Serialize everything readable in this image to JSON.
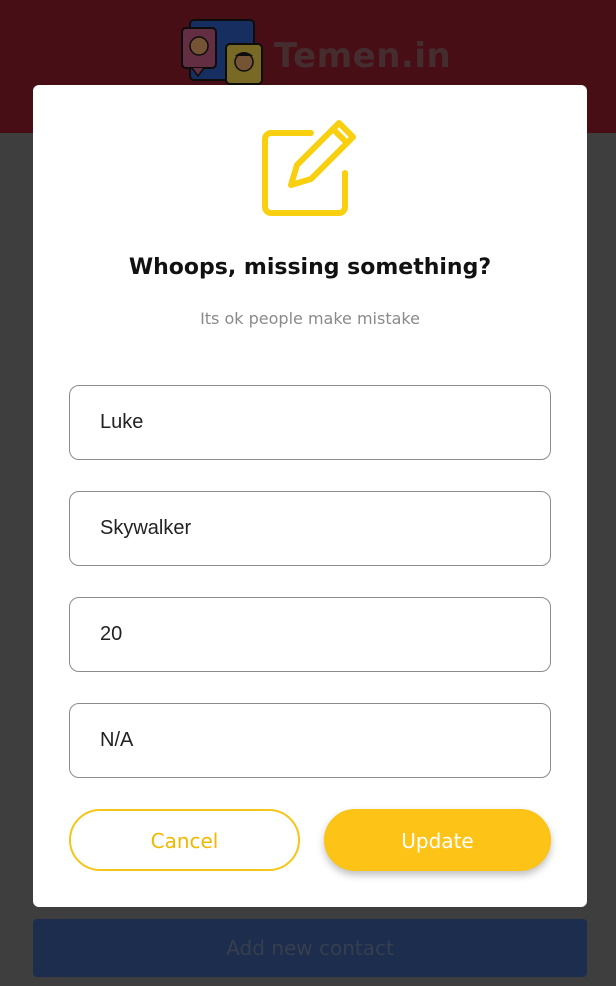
{
  "app": {
    "brand_name": "Temen.in",
    "add_contact_label": "Add new contact"
  },
  "modal": {
    "icon": "edit-icon",
    "title": "Whoops, missing something?",
    "subtitle": "Its ok people make mistake",
    "fields": {
      "first_name": "Luke",
      "last_name": "Skywalker",
      "age": "20",
      "photo": "N/A"
    },
    "cancel_label": "Cancel",
    "update_label": "Update"
  },
  "colors": {
    "header": "#8e1c2c",
    "accent": "#fdc316",
    "primary_button": "#3a5a9a"
  }
}
